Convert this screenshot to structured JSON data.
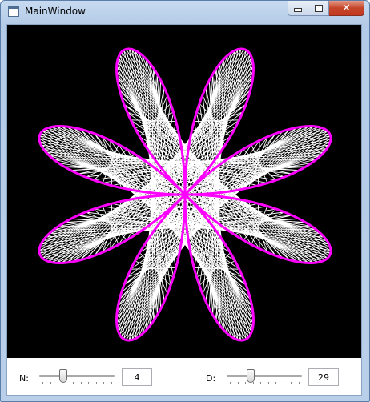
{
  "window": {
    "title": "MainWindow",
    "icons": {
      "app": "window-app-icon",
      "minimize": "minimize-icon",
      "maximize": "maximize-icon",
      "close": "close-icon"
    },
    "close_glyph": "✕"
  },
  "canvas": {
    "background": "#000000",
    "petals": 8,
    "outline_color": "#ff00ff",
    "mesh_color": "#ffffff"
  },
  "controls": {
    "n": {
      "label": "N:",
      "value": "4",
      "slider_fraction": 0.3
    },
    "d": {
      "label": "D:",
      "value": "29",
      "slider_fraction": 0.3
    }
  }
}
